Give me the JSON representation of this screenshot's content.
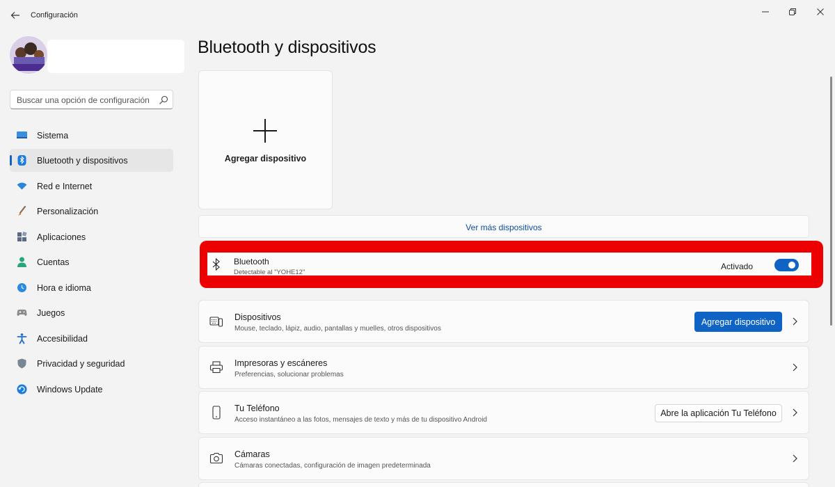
{
  "window": {
    "title": "Configuración"
  },
  "search": {
    "placeholder": "Buscar una opción de configuración"
  },
  "sidebar": {
    "items": [
      {
        "label": "Sistema",
        "icon": "monitor-icon"
      },
      {
        "label": "Bluetooth y dispositivos",
        "icon": "bluetooth-icon",
        "active": true
      },
      {
        "label": "Red e Internet",
        "icon": "wifi-icon"
      },
      {
        "label": "Personalización",
        "icon": "brush-icon"
      },
      {
        "label": "Aplicaciones",
        "icon": "apps-icon"
      },
      {
        "label": "Cuentas",
        "icon": "person-icon"
      },
      {
        "label": "Hora e idioma",
        "icon": "globe-clock-icon"
      },
      {
        "label": "Juegos",
        "icon": "gamepad-icon"
      },
      {
        "label": "Accesibilidad",
        "icon": "accessibility-icon"
      },
      {
        "label": "Privacidad y seguridad",
        "icon": "shield-icon"
      },
      {
        "label": "Windows Update",
        "icon": "update-icon"
      }
    ]
  },
  "main": {
    "title": "Bluetooth y dispositivos",
    "add_tile": {
      "label": "Agregar dispositivo"
    },
    "more_link": "Ver más dispositivos",
    "bluetooth": {
      "title": "Bluetooth",
      "subtitle": "Detectable al \"YOHE12\"",
      "status": "Activado",
      "enabled": true
    },
    "cards": [
      {
        "title": "Dispositivos",
        "subtitle": "Mouse, teclado, lápiz, audio, pantallas y muelles, otros dispositivos",
        "button": "Agregar dispositivo",
        "icon": "keyboard-devices-icon"
      },
      {
        "title": "Impresoras y escáneres",
        "subtitle": "Preferencias, solucionar problemas",
        "icon": "printer-icon"
      },
      {
        "title": "Tu Teléfono",
        "subtitle": "Acceso instantáneo a las fotos, mensajes de texto y más de tu dispositivo Android",
        "button": "Abre la aplicación Tu Teléfono",
        "icon": "phone-icon"
      },
      {
        "title": "Cámaras",
        "subtitle": "Cámaras conectadas, configuración de imagen predeterminada",
        "icon": "camera-icon"
      }
    ]
  },
  "colors": {
    "accent": "#0f63c4",
    "highlight": "#ec0000",
    "background": "#f3f3f3",
    "card": "#fbfbfb"
  }
}
